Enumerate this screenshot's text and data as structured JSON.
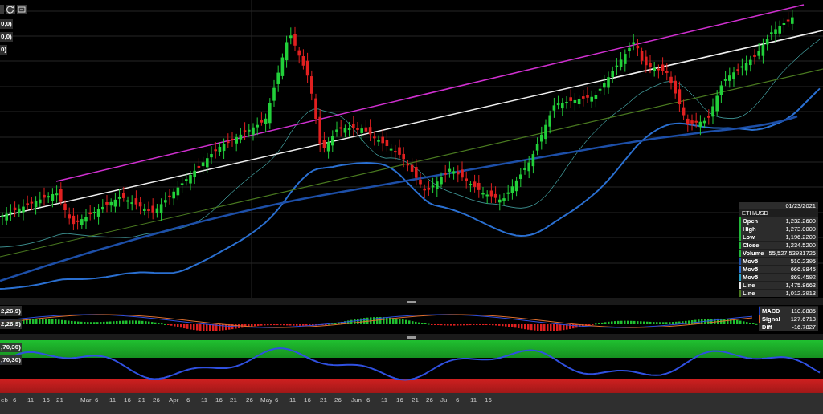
{
  "main_panel": {
    "legend_labels": [
      "0,0)",
      "0,0)",
      "0)"
    ],
    "info_box": {
      "date": "01/23/2021",
      "symbol": "ETH/USD",
      "rows": [
        {
          "label": "Open",
          "value": "1,232.2600",
          "color": "#22b83a"
        },
        {
          "label": "High",
          "value": "1,273.0000",
          "color": "#22b83a"
        },
        {
          "label": "Low",
          "value": "1,196.2200",
          "color": "#22b83a"
        },
        {
          "label": "Close",
          "value": "1,234.5200",
          "color": "#22b83a"
        },
        {
          "label": "Volume",
          "value": "55,527.53931726",
          "color": "#22b83a"
        },
        {
          "label": "Mov5",
          "value": "510.2395",
          "color": "#1d4fa8"
        },
        {
          "label": "Mov5",
          "value": "666.9845",
          "color": "#2a6fd0"
        },
        {
          "label": "Mov5",
          "value": "869.4592",
          "color": "#2aa3c8"
        },
        {
          "label": "Line",
          "value": "1,475.8663",
          "color": "#e8e8e8"
        },
        {
          "label": "Line",
          "value": "1,012.3913",
          "color": "#4a7a20"
        }
      ]
    }
  },
  "macd_panel": {
    "legend_labels": [
      "2,26,9)",
      "2,26,9)"
    ],
    "rows": [
      {
        "label": "MACD",
        "value": "110.8885",
        "color": "#1f3fbf"
      },
      {
        "label": "Signal",
        "value": "127.6713",
        "color": "#d0602a"
      },
      {
        "label": "Diff",
        "value": "-16.7827",
        "color": "#2b2b2b"
      }
    ]
  },
  "rsi_panel": {
    "legend_labels": [
      ",70,30)",
      ",70,30)"
    ]
  },
  "time_axis": {
    "labels": [
      "eb",
      "6",
      "11",
      "16",
      "21",
      "Mar",
      "6",
      "11",
      "16",
      "21",
      "26",
      "Apr",
      "6",
      "11",
      "16",
      "21",
      "26",
      "May",
      "6",
      "11",
      "16",
      "21",
      "26",
      "Jun",
      "6",
      "11",
      "16",
      "21",
      "26",
      "Jul",
      "6",
      "11",
      "16"
    ]
  }
}
